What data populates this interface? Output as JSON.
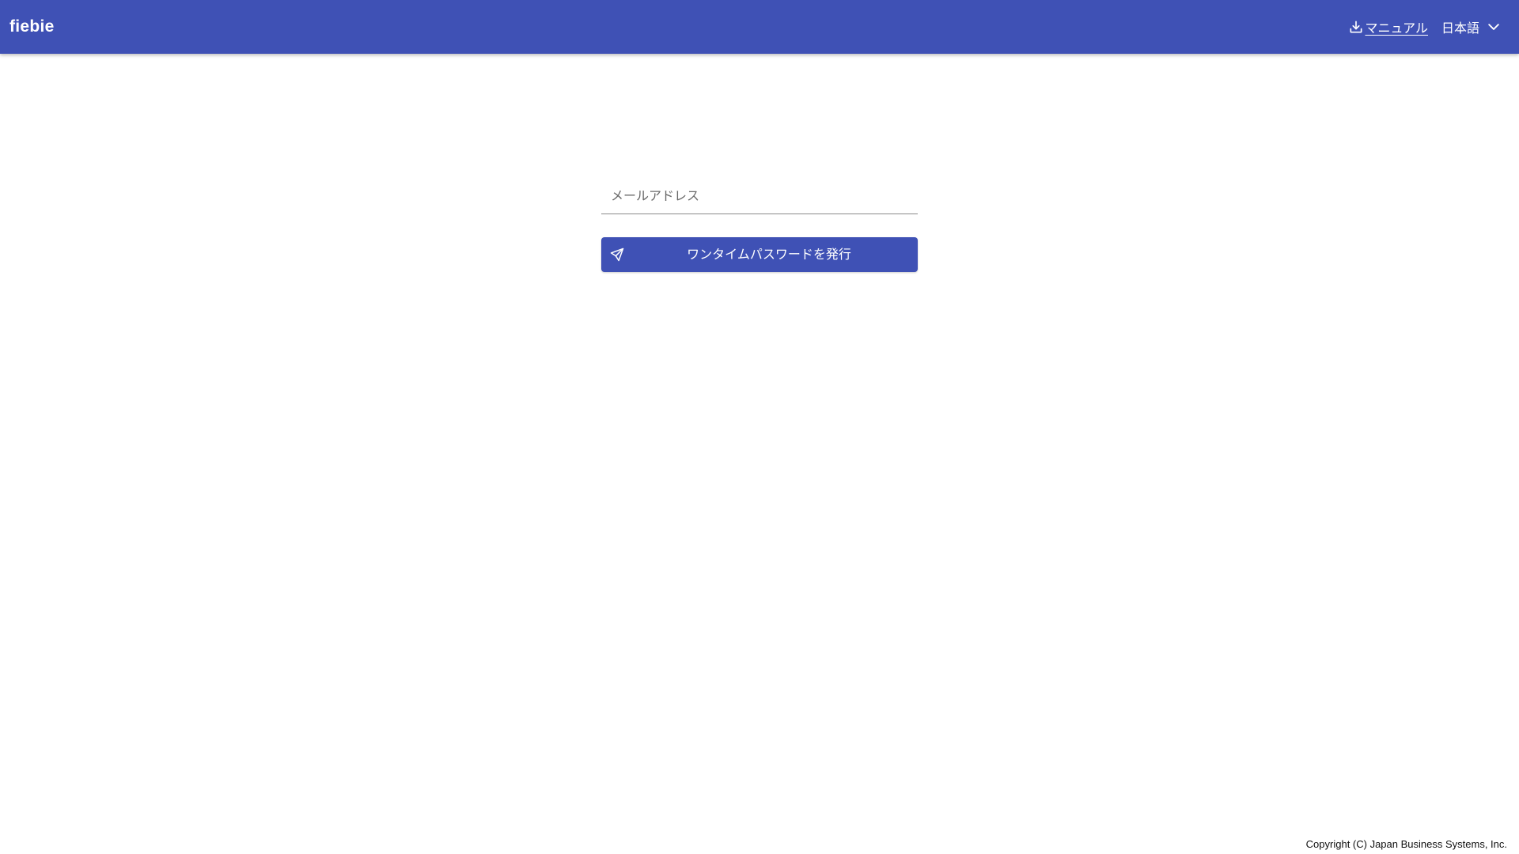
{
  "header": {
    "brand": "fiebie",
    "manual_link": {
      "label": "マニュアル",
      "icon": "download-icon"
    },
    "language_select": {
      "value": "日本語",
      "icon": "chevron-down-icon"
    },
    "background_color": "#3f51b5"
  },
  "login_form": {
    "email_field": {
      "placeholder": "メールアドレス",
      "value": ""
    },
    "submit_button": {
      "label": "ワンタイムパスワードを発行",
      "icon": "send-icon",
      "color": "#3f51b5"
    }
  },
  "footer": {
    "copyright": "Copyright (C) Japan Business Systems, Inc."
  }
}
